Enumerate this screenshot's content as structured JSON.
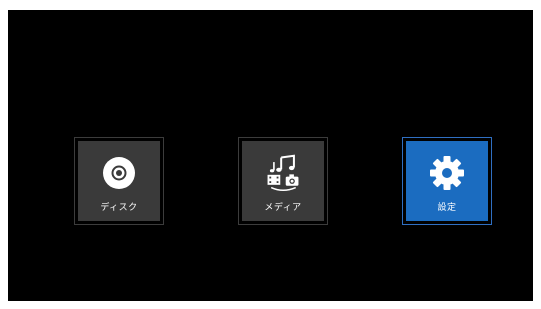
{
  "menu": {
    "items": [
      {
        "label": "ディスク",
        "icon": "disc-icon"
      },
      {
        "label": "メディア",
        "icon": "media-icon"
      },
      {
        "label": "設定",
        "icon": "settings-gear-icon",
        "selected": true
      }
    ]
  },
  "colors": {
    "background": "#000000",
    "tile": "#3a3a3a",
    "tile_selected": "#1b6cc0",
    "label": "#ffffff"
  }
}
